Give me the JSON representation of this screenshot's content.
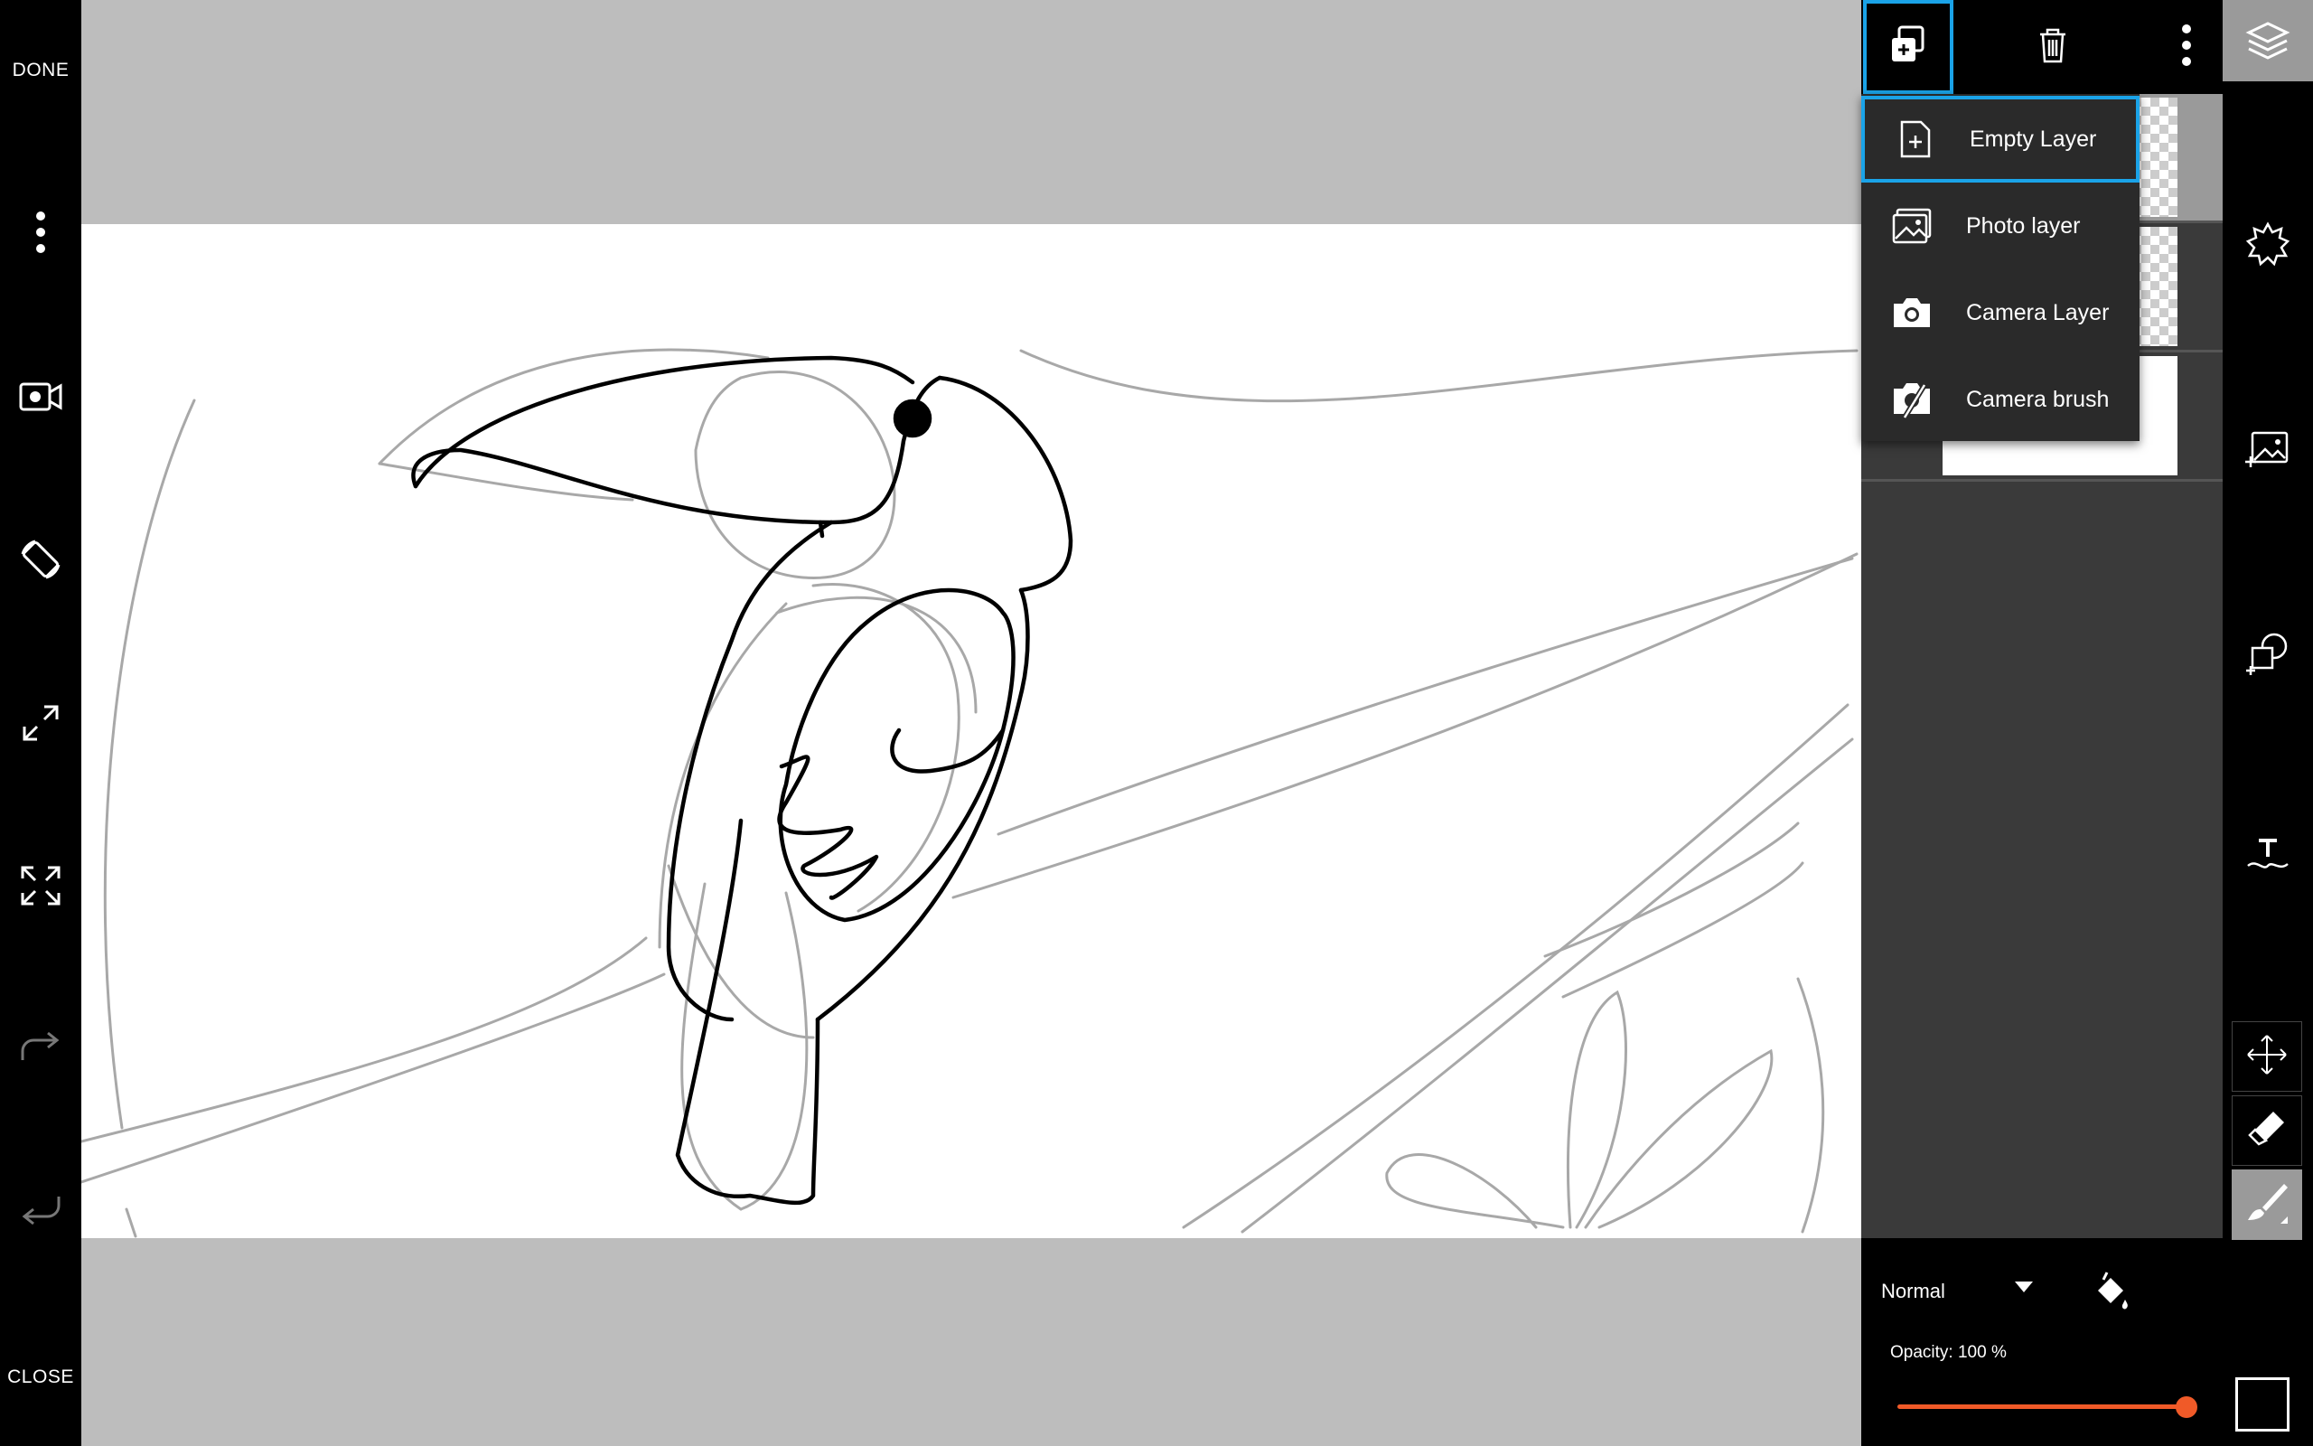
{
  "left_toolbar": {
    "done_label": "DONE",
    "close_label": "CLOSE"
  },
  "layer_panel": {
    "menu": {
      "items": [
        {
          "label": "Empty Layer",
          "icon": "file-plus-icon"
        },
        {
          "label": "Photo layer",
          "icon": "photo-icon"
        },
        {
          "label": "Camera Layer",
          "icon": "camera-icon"
        },
        {
          "label": "Camera brush",
          "icon": "camera-brush-icon"
        }
      ]
    },
    "blend_mode": "Normal",
    "opacity_label": "Opacity:  100 %",
    "opacity_value": 1.0
  },
  "colors": {
    "accent": "#1aa3e8",
    "slider": "#f05a28"
  }
}
